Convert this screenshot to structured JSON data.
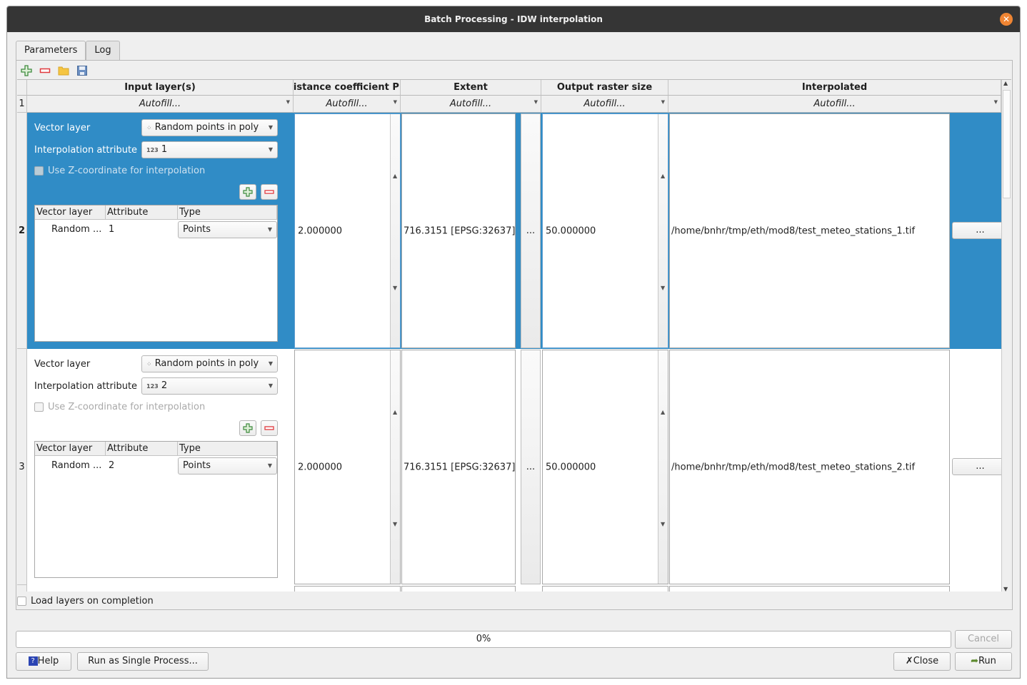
{
  "window": {
    "title": "Batch Processing - IDW interpolation"
  },
  "tabs": [
    {
      "label": "Parameters",
      "active": true
    },
    {
      "label": "Log",
      "active": false
    }
  ],
  "toolbar": {
    "icons": [
      "add-row-icon",
      "remove-row-icon",
      "open-folder-icon",
      "save-icon"
    ]
  },
  "table": {
    "columns": [
      "Input layer(s)",
      "Distance coefficient P",
      "Extent",
      "Output raster size",
      "Interpolated"
    ],
    "autofill_label": "Autofill...",
    "row_numbers": [
      "1",
      "2",
      "3"
    ],
    "rows": [
      {
        "row_number": "2",
        "selected": true,
        "vector_layer_label": "Vector layer",
        "vector_layer_value": "Random points in poly",
        "interp_attr_label": "Interpolation attribute",
        "interp_attr_value": "1",
        "interp_attr_type_badge": "123",
        "use_z_label": "Use Z-coordinate for interpolation",
        "use_z_checked": false,
        "subtable_headers": [
          "Vector layer",
          "Attribute",
          "Type"
        ],
        "subtable_rows": [
          {
            "layer": "Random ...",
            "attribute": "1",
            "type": "Points"
          }
        ],
        "distance_coefficient": "2.000000",
        "extent": "716.3151 [EPSG:32637]",
        "extent_button": "...",
        "output_raster_size": "50.000000",
        "interpolated": "/home/bnhr/tmp/eth/mod8/test_meteo_stations_1.tif",
        "browse_button": "..."
      },
      {
        "row_number": "3",
        "selected": false,
        "vector_layer_label": "Vector layer",
        "vector_layer_value": "Random points in poly",
        "interp_attr_label": "Interpolation attribute",
        "interp_attr_value": "2",
        "interp_attr_type_badge": "123",
        "use_z_label": "Use Z-coordinate for interpolation",
        "use_z_checked": false,
        "subtable_headers": [
          "Vector layer",
          "Attribute",
          "Type"
        ],
        "subtable_rows": [
          {
            "layer": "Random ...",
            "attribute": "2",
            "type": "Points"
          }
        ],
        "distance_coefficient": "2.000000",
        "extent": "716.3151 [EPSG:32637]",
        "extent_button": "...",
        "output_raster_size": "50.000000",
        "interpolated": "/home/bnhr/tmp/eth/mod8/test_meteo_stations_2.tif",
        "browse_button": "..."
      }
    ]
  },
  "load_layers": {
    "label": "Load layers on completion",
    "checked": false
  },
  "progress": {
    "value_percent": 0,
    "label": "0%"
  },
  "buttons": {
    "cancel": "Cancel",
    "help": "Help",
    "run_single": "Run as Single Process...",
    "close": "Close",
    "run": "Run"
  },
  "colors": {
    "selection": "#308cc6",
    "titlebar": "#353535",
    "close_button": "#ef8533"
  }
}
